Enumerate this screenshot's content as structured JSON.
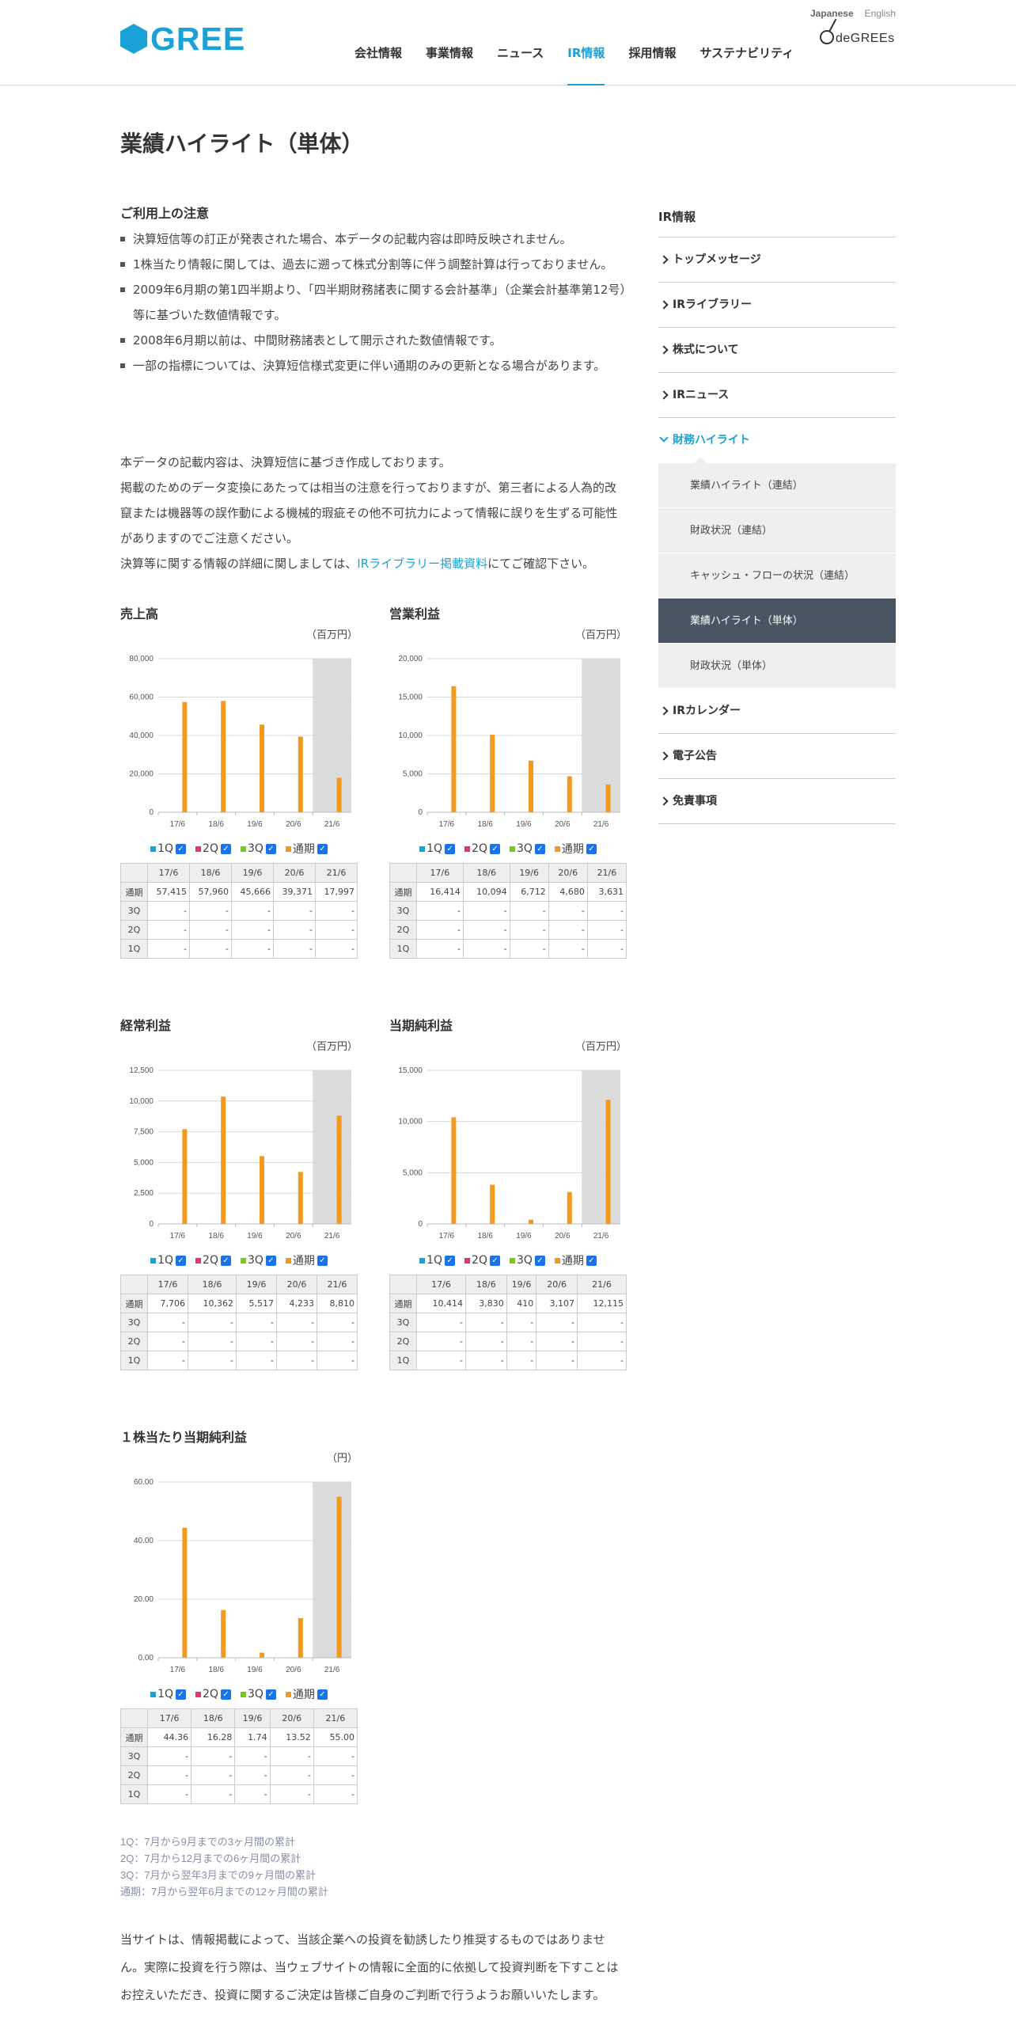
{
  "header": {
    "logo_text": "GREE",
    "lang": {
      "japanese": "Japanese",
      "english": "English"
    },
    "nav": [
      "会社情報",
      "事業情報",
      "ニュース",
      "IR情報",
      "採用情報",
      "サステナビリティ"
    ],
    "nav_active_index": 3,
    "degrees_text": "deGREEs"
  },
  "page": {
    "title": "業績ハイライト（単体）",
    "notice_title": "ご利用上の注意",
    "notice_items": [
      "決算短信等の訂正が発表された場合、本データの記載内容は即時反映されません。",
      "1株当たり情報に関しては、過去に遡って株式分割等に伴う調整計算は行っておりません。",
      "2009年6月期の第1四半期より、「四半期財務諸表に関する会計基準」（企業会計基準第12号）等に基づいた数値情報です。",
      "2008年6月期以前は、中間財務諸表として開示された数値情報です。",
      "一部の指標については、決算短信様式変更に伴い通期のみの更新となる場合があります。"
    ],
    "para1": "本データの記載内容は、決算短信に基づき作成しております。",
    "para2": "掲載のためのデータ変換にあたっては相当の注意を行っておりますが、第三者による人為的改竄または機器等の誤作動による機械的瑕疵その他不可抗力によって情報に誤りを生ずる可能性がありますのでご注意ください。",
    "para3_pre": "決算等に関する情報の詳細に関しましては、",
    "para3_link": "IRライブラリー掲載資料",
    "para3_post": "にてご確認下さい。",
    "foot_notes": [
      "1Q：7月から9月までの3ヶ月間の累計",
      "2Q：7月から12月までの6ヶ月間の累計",
      "3Q：7月から翌年3月までの9ヶ月間の累計",
      "通期：7月から翌年6月までの12ヶ月間の累計"
    ],
    "disclaimer": "当サイトは、情報掲載によって、当該企業への投資を勧誘したり推奨するものではありません。実際に投資を行う際は、当ウェブサイトの情報に全面的に依拠して投資判断を下すことはお控えいただき、投資に関するご決定は皆様ご自身のご判断で行うようお願いいたします。"
  },
  "legend": {
    "q1": "1Q",
    "q2": "2Q",
    "q3": "3Q",
    "fy": "通期"
  },
  "colors": {
    "q1": "#1aa2d8",
    "q2": "#e8336d",
    "q3": "#7cc428",
    "fy": "#f39a1e",
    "accent": "#1aa2d8"
  },
  "table_rows": [
    "通期",
    "3Q",
    "2Q",
    "1Q"
  ],
  "chart_data": [
    {
      "type": "bar",
      "title": "売上高",
      "unit": "（百万円）",
      "categories": [
        "17/6",
        "18/6",
        "19/6",
        "20/6",
        "21/6"
      ],
      "ylim": [
        0,
        80000
      ],
      "yticks": [
        "0",
        "20,000",
        "40,000",
        "60,000",
        "80,000"
      ],
      "series": [
        {
          "name": "通期",
          "values": [
            57415,
            57960,
            45666,
            39371,
            17997
          ]
        }
      ],
      "table_values": [
        "57,415",
        "57,960",
        "45,666",
        "39,371",
        "17,997"
      ]
    },
    {
      "type": "bar",
      "title": "営業利益",
      "unit": "（百万円）",
      "categories": [
        "17/6",
        "18/6",
        "19/6",
        "20/6",
        "21/6"
      ],
      "ylim": [
        0,
        20000
      ],
      "yticks": [
        "0",
        "5,000",
        "10,000",
        "15,000",
        "20,000"
      ],
      "series": [
        {
          "name": "通期",
          "values": [
            16414,
            10094,
            6712,
            4680,
            3631
          ]
        }
      ],
      "table_values": [
        "16,414",
        "10,094",
        "6,712",
        "4,680",
        "3,631"
      ]
    },
    {
      "type": "bar",
      "title": "経常利益",
      "unit": "（百万円）",
      "categories": [
        "17/6",
        "18/6",
        "19/6",
        "20/6",
        "21/6"
      ],
      "ylim": [
        0,
        12500
      ],
      "yticks": [
        "0",
        "2,500",
        "5,000",
        "7,500",
        "10,000",
        "12,500"
      ],
      "series": [
        {
          "name": "通期",
          "values": [
            7706,
            10362,
            5517,
            4233,
            8810
          ]
        }
      ],
      "table_values": [
        "7,706",
        "10,362",
        "5,517",
        "4,233",
        "8,810"
      ]
    },
    {
      "type": "bar",
      "title": "当期純利益",
      "unit": "（百万円）",
      "categories": [
        "17/6",
        "18/6",
        "19/6",
        "20/6",
        "21/6"
      ],
      "ylim": [
        0,
        15000
      ],
      "yticks": [
        "0",
        "5,000",
        "10,000",
        "15,000"
      ],
      "series": [
        {
          "name": "通期",
          "values": [
            10414,
            3830,
            410,
            3107,
            12115
          ]
        }
      ],
      "table_values": [
        "10,414",
        "3,830",
        "410",
        "3,107",
        "12,115"
      ]
    },
    {
      "type": "bar",
      "title": "１株当たり当期純利益",
      "unit": "（円）",
      "categories": [
        "17/6",
        "18/6",
        "19/6",
        "20/6",
        "21/6"
      ],
      "ylim": [
        0,
        60
      ],
      "yticks": [
        "0.00",
        "20.00",
        "40.00",
        "60.00"
      ],
      "series": [
        {
          "name": "通期",
          "values": [
            44.36,
            16.28,
            1.74,
            13.52,
            55.0
          ]
        }
      ],
      "table_values": [
        "44.36",
        "16.28",
        "1.74",
        "13.52",
        "55.00"
      ]
    }
  ],
  "sidebar": {
    "title": "IR情報",
    "items_before": [
      "トップメッセージ",
      "IRライブラリー",
      "株式について",
      "IRニュース"
    ],
    "open_item": "財務ハイライト",
    "sub_items": [
      "業績ハイライト（連結）",
      "財政状況（連結）",
      "キャッシュ・フローの状況（連結）",
      "業績ハイライト（単体）",
      "財政状況（単体）"
    ],
    "sub_current_index": 3,
    "items_after": [
      "IRカレンダー",
      "電子公告",
      "免責事項"
    ]
  }
}
